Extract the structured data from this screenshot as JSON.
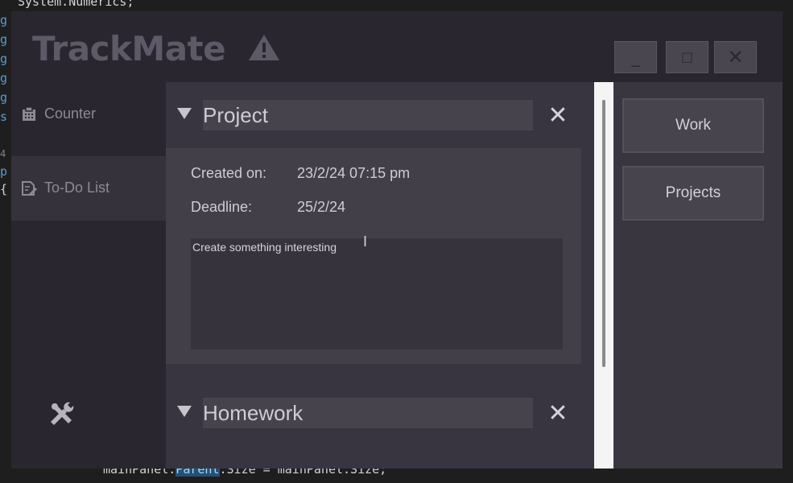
{
  "background_code": {
    "top_line": "System.Numerics;",
    "bottom_line_prefix": "mainPanel.",
    "bottom_line_highlight": "Parent",
    "bottom_line_suffix": ".Size = mainPanel.Size;",
    "gutter_chars": [
      "g",
      "g",
      "g",
      "g",
      "g",
      "s",
      "4",
      "p",
      "{"
    ]
  },
  "app": {
    "title": "TrackMate",
    "title_icon": "warning-triangle-icon",
    "window_buttons": {
      "minimize": "_",
      "maximize": "□",
      "close": "✕"
    }
  },
  "sidebar": {
    "items": [
      {
        "label": "Counter",
        "icon": "clipboard-icon"
      },
      {
        "label": "To-Do List",
        "icon": "document-edit-icon"
      }
    ],
    "bottom_icon": "tools-icon"
  },
  "tasks": [
    {
      "title": "Project",
      "created_label": "Created on:",
      "created_value": "23/2/24 07:15 pm",
      "deadline_label": "Deadline:",
      "deadline_value": "25/2/24",
      "description": "Create something interesting"
    },
    {
      "title": "Homework"
    }
  ],
  "categories": [
    "Work",
    "Projects"
  ],
  "colors": {
    "app_bg": "#2a262f",
    "panel_bg": "#393540",
    "card_bg": "#433f49",
    "accent_text": "#d0ccd4"
  }
}
